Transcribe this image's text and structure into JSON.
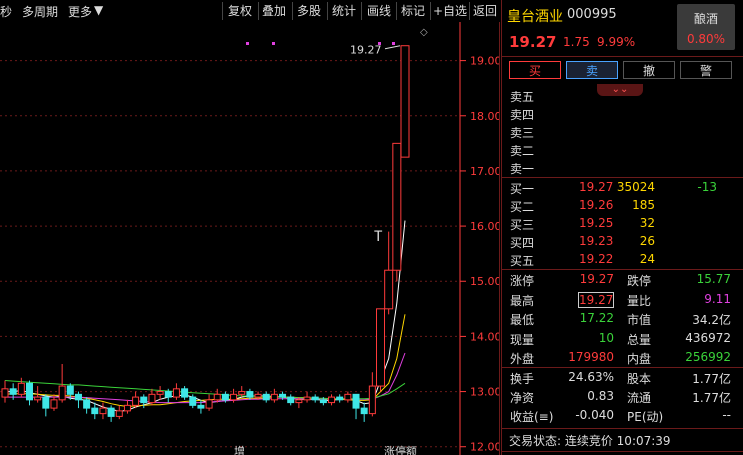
{
  "toolbar": {
    "left_items": [
      "秒",
      "多周期",
      "更多"
    ],
    "buttons": [
      "复权",
      "叠加",
      "多股",
      "统计",
      "画线",
      "标记",
      "+自选",
      "返回"
    ]
  },
  "chart": {
    "y_ticks": [
      "19.00",
      "18.00",
      "17.00",
      "16.00",
      "15.00",
      "14.00",
      "13.00",
      "12.00"
    ],
    "annotation_price": "19.27",
    "marker_text": "T",
    "bottom_labels": [
      "增",
      "涨停额"
    ],
    "colors": {
      "up": "#ff3b3b",
      "down": "#3fe6e6",
      "ma5": "#ffffff",
      "ma10": "#ffd700",
      "ma20": "#e040e0",
      "ma60": "#3ad23a",
      "axis": "#ff3b3b",
      "grid": "#6b1a1a"
    }
  },
  "chart_data": {
    "type": "candlestick",
    "y_range": [
      11.85,
      19.7
    ],
    "candles": [
      [
        12.9,
        13.05,
        13.2,
        12.8
      ],
      [
        13.05,
        12.95,
        13.15,
        12.85
      ],
      [
        12.95,
        13.15,
        13.25,
        12.9
      ],
      [
        13.15,
        12.85,
        13.2,
        12.75
      ],
      [
        12.85,
        12.9,
        13.1,
        12.8
      ],
      [
        12.9,
        12.7,
        12.95,
        12.55
      ],
      [
        12.7,
        12.85,
        12.95,
        12.65
      ],
      [
        12.85,
        13.1,
        13.5,
        12.8
      ],
      [
        13.1,
        12.95,
        13.15,
        12.85
      ],
      [
        12.95,
        12.85,
        13.0,
        12.7
      ],
      [
        12.85,
        12.7,
        12.9,
        12.6
      ],
      [
        12.7,
        12.6,
        12.8,
        12.5
      ],
      [
        12.6,
        12.7,
        12.8,
        12.5
      ],
      [
        12.7,
        12.55,
        12.75,
        12.45
      ],
      [
        12.55,
        12.65,
        12.75,
        12.5
      ],
      [
        12.65,
        12.75,
        12.85,
        12.6
      ],
      [
        12.75,
        12.9,
        13.0,
        12.7
      ],
      [
        12.9,
        12.8,
        12.95,
        12.7
      ],
      [
        12.8,
        12.95,
        13.05,
        12.75
      ],
      [
        12.95,
        13.0,
        13.1,
        12.85
      ],
      [
        13.0,
        12.9,
        13.05,
        12.8
      ],
      [
        12.9,
        13.05,
        13.15,
        12.85
      ],
      [
        13.05,
        12.9,
        13.1,
        12.85
      ],
      [
        12.9,
        12.75,
        12.95,
        12.7
      ],
      [
        12.75,
        12.7,
        12.85,
        12.6
      ],
      [
        12.7,
        12.85,
        12.95,
        12.65
      ],
      [
        12.85,
        12.95,
        13.05,
        12.8
      ],
      [
        12.95,
        12.85,
        13.0,
        12.8
      ],
      [
        12.85,
        12.95,
        13.05,
        12.8
      ],
      [
        12.95,
        13.0,
        13.1,
        12.9
      ],
      [
        13.0,
        12.9,
        13.05,
        12.85
      ],
      [
        12.9,
        12.95,
        13.0,
        12.85
      ],
      [
        12.95,
        12.85,
        13.0,
        12.8
      ],
      [
        12.85,
        12.95,
        13.05,
        12.8
      ],
      [
        12.95,
        12.9,
        13.0,
        12.85
      ],
      [
        12.9,
        12.8,
        12.95,
        12.75
      ],
      [
        12.8,
        12.85,
        12.9,
        12.7
      ],
      [
        12.85,
        12.9,
        13.0,
        12.8
      ],
      [
        12.9,
        12.85,
        12.95,
        12.8
      ],
      [
        12.85,
        12.8,
        12.9,
        12.75
      ],
      [
        12.8,
        12.9,
        12.95,
        12.75
      ],
      [
        12.9,
        12.85,
        12.95,
        12.8
      ],
      [
        12.85,
        12.95,
        13.0,
        12.8
      ],
      [
        12.95,
        12.7,
        12.95,
        12.5
      ],
      [
        12.7,
        12.6,
        12.8,
        12.45
      ],
      [
        12.6,
        13.1,
        13.35,
        12.55
      ],
      [
        13.1,
        14.5,
        14.5,
        13.0
      ],
      [
        14.5,
        15.2,
        15.9,
        14.4
      ],
      [
        15.2,
        17.5,
        17.5,
        15.0
      ],
      [
        17.25,
        19.27,
        19.27,
        17.25
      ]
    ],
    "ma_series": [
      {
        "name": "MA5",
        "values": [
          13.0,
          13.0,
          13.02,
          12.98,
          12.95,
          12.92,
          12.9,
          12.92,
          12.88,
          12.86,
          12.84,
          12.78,
          12.72,
          12.68,
          12.64,
          12.66,
          12.72,
          12.76,
          12.8,
          12.86,
          12.9,
          12.92,
          12.94,
          12.9,
          12.84,
          12.8,
          12.82,
          12.84,
          12.86,
          12.9,
          12.92,
          12.92,
          12.92,
          12.91,
          12.9,
          12.88,
          12.86,
          12.86,
          12.86,
          12.84,
          12.84,
          12.86,
          12.86,
          12.84,
          12.78,
          12.8,
          13.2,
          13.6,
          14.6,
          16.1
        ]
      },
      {
        "name": "MA10",
        "values": [
          12.95,
          12.96,
          12.96,
          12.96,
          12.95,
          12.94,
          12.93,
          12.93,
          12.92,
          12.9,
          12.88,
          12.85,
          12.82,
          12.78,
          12.75,
          12.73,
          12.74,
          12.75,
          12.76,
          12.76,
          12.78,
          12.8,
          12.82,
          12.83,
          12.84,
          12.85,
          12.86,
          12.86,
          12.86,
          12.87,
          12.88,
          12.88,
          12.89,
          12.9,
          12.9,
          12.9,
          12.89,
          12.89,
          12.88,
          12.87,
          12.86,
          12.86,
          12.85,
          12.84,
          12.84,
          12.85,
          13.0,
          13.15,
          13.6,
          14.4
        ]
      },
      {
        "name": "MA20",
        "values": [
          12.9,
          12.9,
          12.9,
          12.9,
          12.9,
          12.9,
          12.9,
          12.9,
          12.9,
          12.9,
          12.89,
          12.88,
          12.87,
          12.86,
          12.85,
          12.84,
          12.83,
          12.82,
          12.81,
          12.8,
          12.8,
          12.8,
          12.8,
          12.8,
          12.8,
          12.81,
          12.82,
          12.83,
          12.84,
          12.85,
          12.86,
          12.86,
          12.87,
          12.87,
          12.87,
          12.87,
          12.87,
          12.87,
          12.87,
          12.87,
          12.87,
          12.87,
          12.87,
          12.86,
          12.86,
          12.86,
          12.92,
          13.0,
          13.3,
          13.7
        ]
      },
      {
        "name": "MA60",
        "values": [
          13.2,
          13.19,
          13.18,
          13.17,
          13.16,
          13.15,
          13.14,
          13.13,
          13.12,
          13.12,
          13.11,
          13.1,
          13.09,
          13.08,
          13.07,
          13.06,
          13.05,
          13.04,
          13.03,
          13.02,
          13.01,
          13.0,
          12.99,
          12.98,
          12.97,
          12.96,
          12.95,
          12.94,
          12.93,
          12.92,
          12.92,
          12.91,
          12.91,
          12.9,
          12.9,
          12.89,
          12.89,
          12.88,
          12.88,
          12.88,
          12.87,
          12.87,
          12.87,
          12.87,
          12.87,
          12.88,
          12.92,
          12.96,
          13.05,
          13.15
        ]
      }
    ]
  },
  "panel": {
    "stock_name": "皇台酒业",
    "stock_code": "000995",
    "sector_name": "酿酒",
    "sector_pct": "0.80%",
    "price": "19.27",
    "change": "1.75",
    "change_pct": "9.99%",
    "actions": [
      "买",
      "卖",
      "撤",
      "警"
    ],
    "asks": [
      {
        "label": "卖五",
        "price": "",
        "vol": ""
      },
      {
        "label": "卖四",
        "price": "",
        "vol": ""
      },
      {
        "label": "卖三",
        "price": "",
        "vol": ""
      },
      {
        "label": "卖二",
        "price": "",
        "vol": ""
      },
      {
        "label": "卖一",
        "price": "",
        "vol": ""
      }
    ],
    "bids": [
      {
        "label": "买一",
        "price": "19.27",
        "vol": "35024",
        "extra": "-13"
      },
      {
        "label": "买二",
        "price": "19.26",
        "vol": "185",
        "extra": ""
      },
      {
        "label": "买三",
        "price": "19.25",
        "vol": "32",
        "extra": ""
      },
      {
        "label": "买四",
        "price": "19.23",
        "vol": "26",
        "extra": ""
      },
      {
        "label": "买五",
        "price": "19.22",
        "vol": "24",
        "extra": ""
      }
    ],
    "stats1": [
      {
        "l1": "涨停",
        "v1": "19.27",
        "c1": "#ff3b3b",
        "l2": "跌停",
        "v2": "15.77",
        "c2": "#3ad23a"
      },
      {
        "l1": "最高",
        "v1": "19.27",
        "c1": "#ff3b3b",
        "l2": "量比",
        "v2": "9.11",
        "c2": "#e040e0"
      },
      {
        "l1": "最低",
        "v1": "17.22",
        "c1": "#3ad23a",
        "l2": "市值",
        "v2": "34.2亿",
        "c2": "#ddd"
      },
      {
        "l1": "现量",
        "v1": "10",
        "c1": "#3ad23a",
        "l2": "总量",
        "v2": "436972",
        "c2": "#ddd"
      },
      {
        "l1": "外盘",
        "v1": "179980",
        "c1": "#ff3b3b",
        "l2": "内盘",
        "v2": "256992",
        "c2": "#3ad23a"
      }
    ],
    "stats2": [
      {
        "l1": "换手",
        "v1": "24.63%",
        "c1": "#ddd",
        "l2": "股本",
        "v2": "1.77亿",
        "c2": "#ddd"
      },
      {
        "l1": "净资",
        "v1": "0.83",
        "c1": "#ddd",
        "l2": "流通",
        "v2": "1.77亿",
        "c2": "#ddd"
      },
      {
        "l1": "收益(≡)",
        "v1": "-0.040",
        "c1": "#ddd",
        "l2": "PE(动)",
        "v2": "--",
        "c2": "#ddd"
      }
    ],
    "trade_status": "交易状态: 连续竞价 10:07:39"
  }
}
